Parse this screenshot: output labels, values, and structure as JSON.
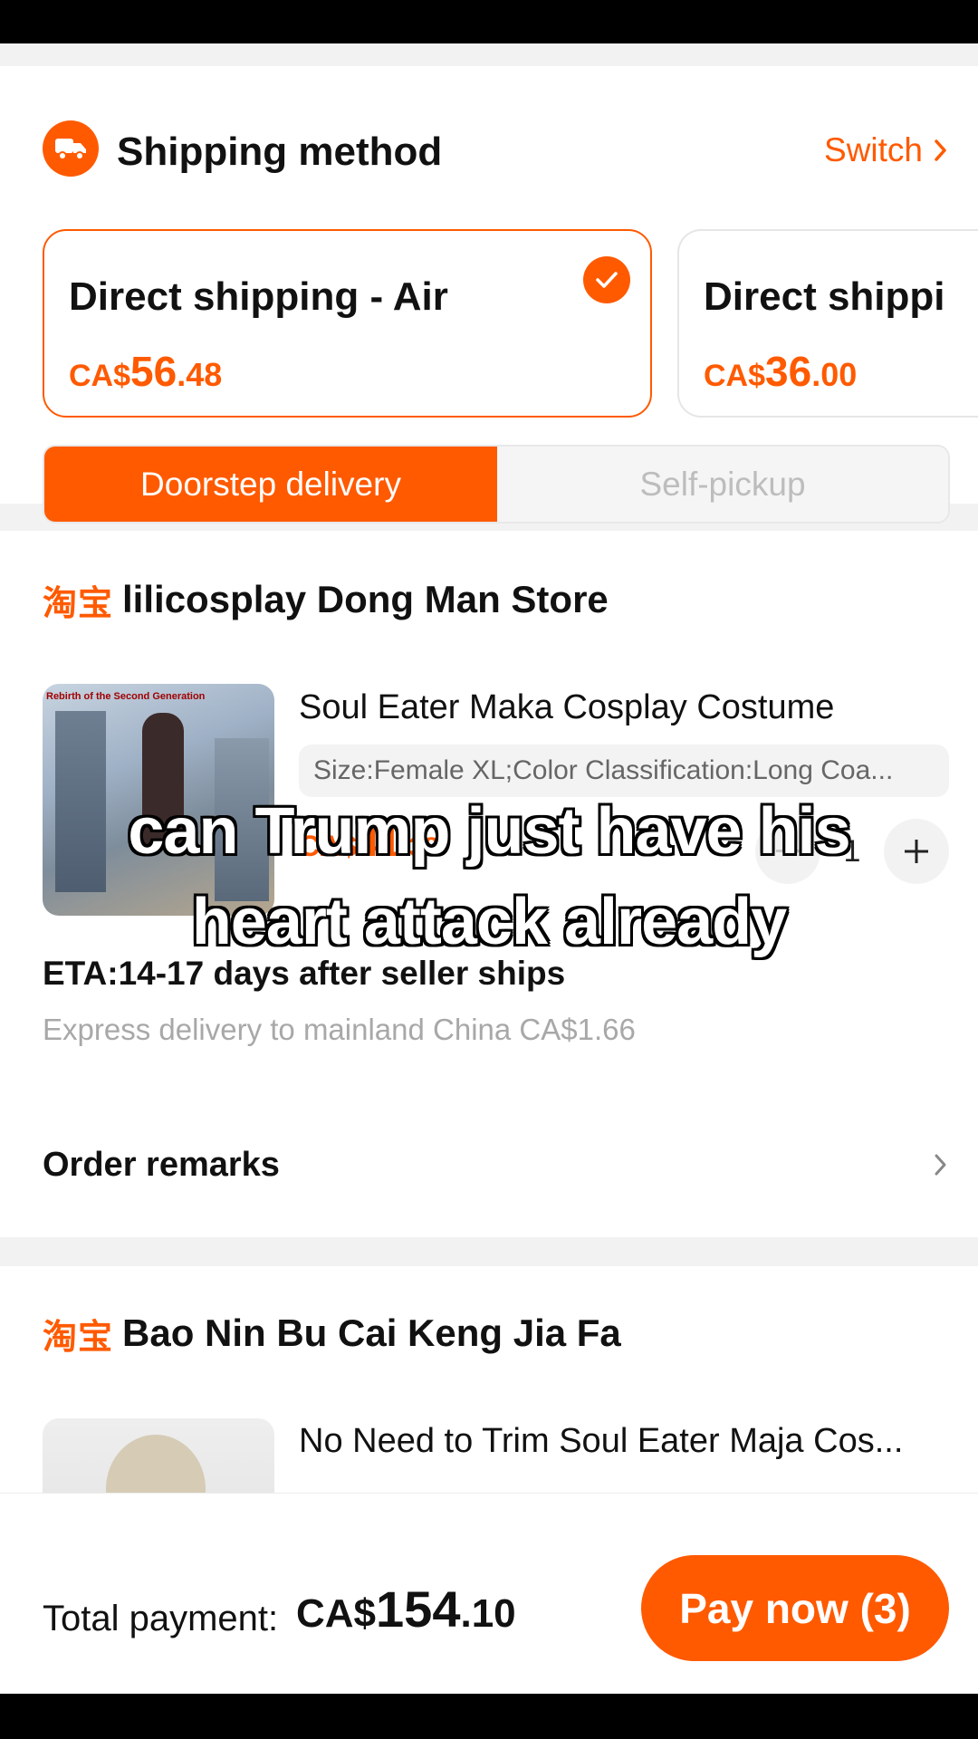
{
  "shipping": {
    "title": "Shipping method",
    "switch_label": "Switch",
    "icon": "truck-icon",
    "options": [
      {
        "name": "Direct shipping - Air",
        "price_cur": "CA$",
        "price_big": "56",
        "price_small": ".48",
        "selected": true
      },
      {
        "name": "Direct shippi",
        "price_cur": "CA$",
        "price_big": "36",
        "price_small": ".00",
        "selected": false
      }
    ],
    "delivery_toggle": {
      "active": "Doorstep delivery",
      "inactive": "Self-pickup"
    }
  },
  "stores": [
    {
      "platform": "淘宝",
      "name": "lilicosplay Dong Man Store",
      "product": {
        "thumb_caption": "Rebirth of the Second Generation",
        "title": "Soul Eater Maka Cosplay Costume",
        "sku": "Size:Female XL;Color Classification:Long Coa...",
        "price_cur": "CA$",
        "price_big": "41",
        "price_small": ".38",
        "quantity": "1"
      },
      "eta": "ETA:14-17 days after seller ships",
      "express": "Express delivery to mainland China CA$1.66",
      "remarks_label": "Order remarks"
    },
    {
      "platform": "淘宝",
      "name": "Bao Nin Bu Cai Keng Jia Fa",
      "product": {
        "title": "No Need to Trim Soul Eater Maja Cos..."
      }
    }
  ],
  "footer": {
    "total_label": "Total payment: ",
    "total_cur": "CA$",
    "total_big": "154",
    "total_small": ".10",
    "pay_label": "Pay now (3)"
  },
  "overlay_caption": {
    "line1": "can Trump just have his",
    "line2": "heart attack already"
  },
  "colors": {
    "accent": "#ff5a00",
    "muted": "#a8a8a8"
  }
}
